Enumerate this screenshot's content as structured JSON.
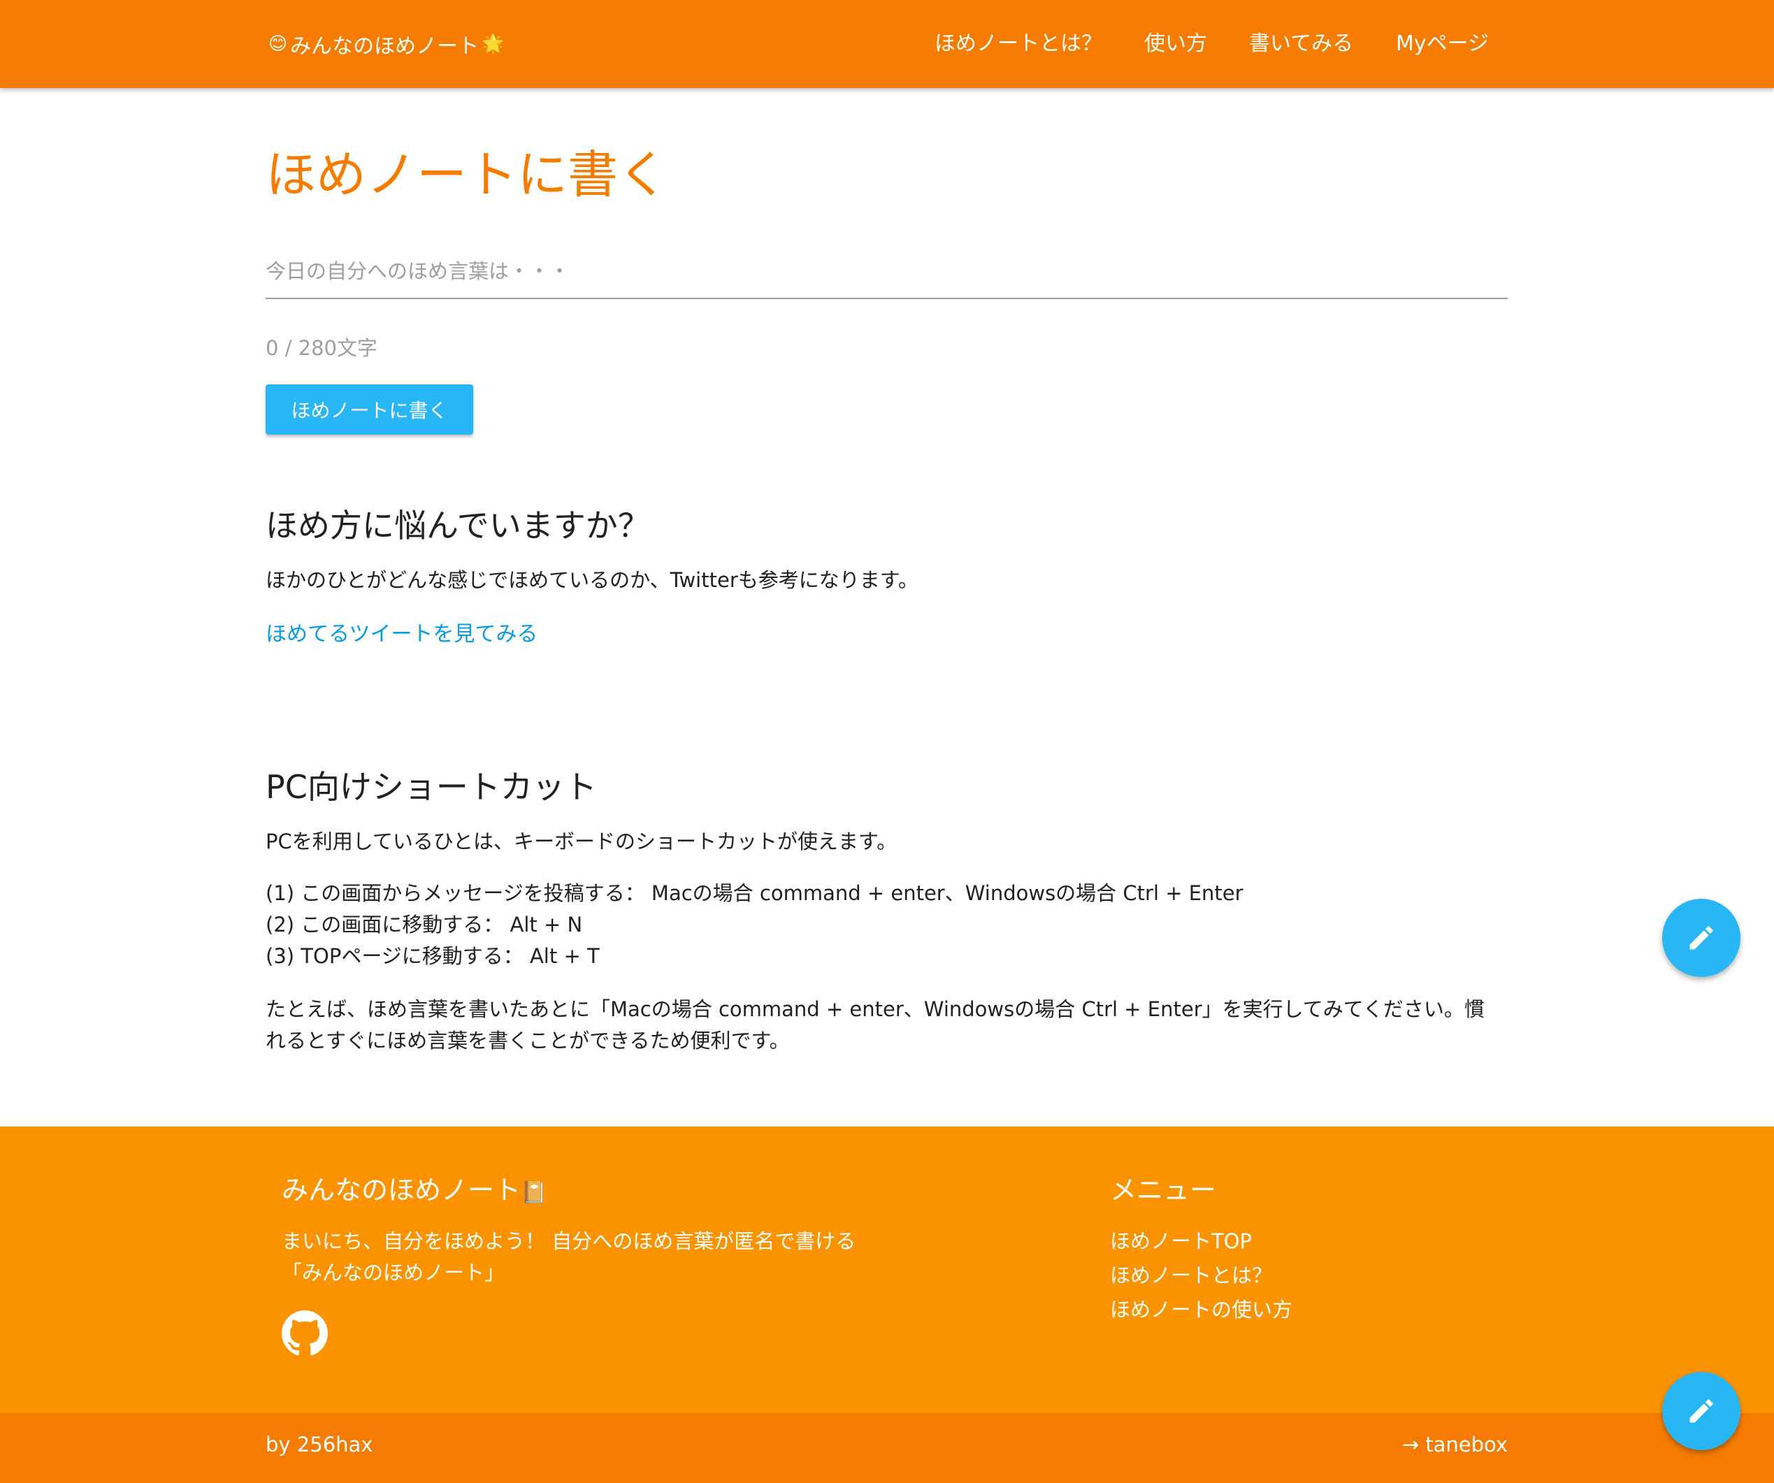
{
  "nav": {
    "brand_text": "みんなのほめノート",
    "brand_emoji_left": "😊",
    "brand_emoji_right": "🌟",
    "links": [
      "ほめノートとは？",
      "使い方",
      "書いてみる",
      "Myページ"
    ]
  },
  "main": {
    "title": "ほめノートに書く",
    "input_placeholder": "今日の自分へのほめ言葉は・・・",
    "input_value": "",
    "counter": "0 / 280文字",
    "submit_label": "ほめノートに書く",
    "help_heading": "ほめ方に悩んでいますか？",
    "help_text": "ほかのひとがどんな感じでほめているのか、Twitterも参考になります。",
    "help_link": "ほめてるツイートを見てみる",
    "shortcut_heading": "PC向けショートカット",
    "shortcut_intro": "PCを利用しているひとは、キーボードのショートカットが使えます。",
    "shortcuts": [
      "(1) この画面からメッセージを投稿する： Macの場合 command + enter、Windowsの場合 Ctrl + Enter",
      "(2) この画面に移動する： Alt + N",
      "(3) TOPページに移動する： Alt + T"
    ],
    "shortcut_tip": "たとえば、ほめ言葉を書いたあとに「Macの場合 command + enter、Windowsの場合 Ctrl + Enter」を実行してみてください。慣れるとすぐにほめ言葉を書くことができるため便利です。"
  },
  "footer": {
    "title": "みんなのほめノート",
    "title_emoji": "📔",
    "description": "まいにち、自分をほめよう！ 自分へのほめ言葉が匿名で書ける「みんなのほめノート」",
    "github_icon": "github-icon",
    "menu_title": "メニュー",
    "menu_items": [
      "ほめノートTOP",
      "ほめノートとは？",
      "ほめノートの使い方"
    ],
    "by": "by 256hax",
    "tanebox": "→ tanebox"
  },
  "colors": {
    "nav": "#f57c00",
    "footer": "#fb9300",
    "accent_button": "#29b6f6",
    "link": "#039be5"
  }
}
